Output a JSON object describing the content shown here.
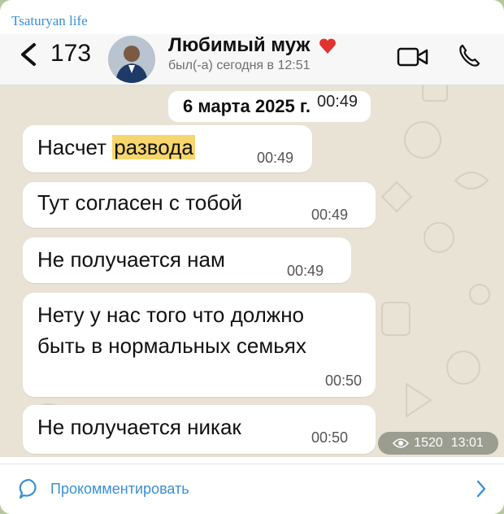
{
  "post": {
    "channel_name": "Tsaturyan life",
    "views": "1520",
    "post_time": "13:01",
    "comment_label": "Прокомментировать"
  },
  "chat": {
    "back_count": "173",
    "contact_name": "Любимый муж",
    "contact_status": "был(-а) сегодня в 12:51",
    "date_separator": "6 марта 2025 г.",
    "date_time": "00:49",
    "messages": [
      {
        "text_before": "Насчет ",
        "highlight": "развода",
        "time": "00:49"
      },
      {
        "text": "Тут согласен с тобой",
        "time": "00:49"
      },
      {
        "text": "Не получается нам",
        "time": "00:49"
      },
      {
        "line1": "Нету у нас того что должно",
        "line2": "быть в нормальных семьях",
        "time": "00:50"
      },
      {
        "text": "Не получается никак",
        "time": "00:50"
      }
    ]
  },
  "colors": {
    "accent": "#3a8fd6",
    "highlight": "#f6d66d",
    "chat_background": "#e8e3d4",
    "heart": "#e0332f"
  },
  "icons": [
    "back-chevron-icon",
    "heart-icon",
    "video-call-icon",
    "phone-icon",
    "eye-icon",
    "comment-bubble-icon",
    "chevron-right-icon"
  ]
}
